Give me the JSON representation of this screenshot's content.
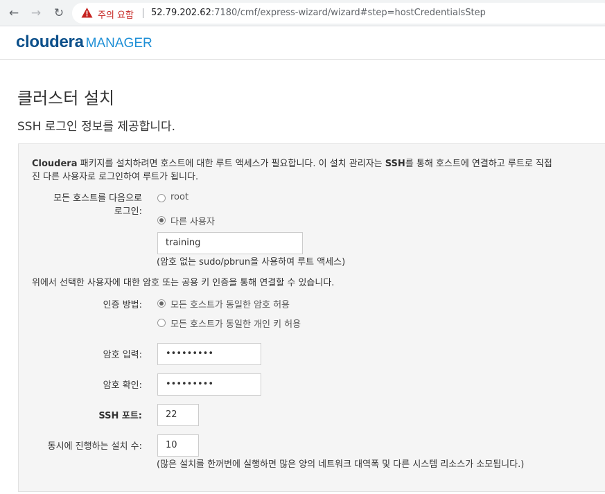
{
  "browser": {
    "warning": "주의 요함",
    "url_host": "52.79.202.62",
    "url_rest": ":7180/cmf/express-wizard/wizard#step=hostCredentialsStep"
  },
  "header": {
    "logo_brand": "cloudera",
    "logo_product": "MANAGER"
  },
  "page": {
    "title": "클러스터 설치",
    "subtitle": "SSH 로그인 정보를 제공합니다."
  },
  "intro": {
    "part1": "Cloudera",
    "part2": " 패키지를 설치하려면 호스트에 대한 루트 액세스가 필요합니다. 이 설치 관리자는 ",
    "part3": "SSH",
    "part4": "를 통해 호스트에 연결하고 루트로 직접",
    "line2": "진 다른 사용자로 로그인하여 루트가 됩니다."
  },
  "login": {
    "label_line1": "모든 호스트를 다음으로",
    "label_line2": "로그인:",
    "option_root": "root",
    "option_other": "다른 사용자",
    "username": "training",
    "username_hint": "(암호 없는 sudo/pbrun을 사용하여 루트 액세스)"
  },
  "auth_note": "위에서 선택한 사용자에 대한 암호 또는 공용 키 인증을 통해 연결할 수 있습니다.",
  "auth": {
    "label": "인증 방법:",
    "option_password": "모든 호스트가 동일한 암호 허용",
    "option_key": "모든 호스트가 동일한 개인 키 허용"
  },
  "password": {
    "label": "암호 입력:",
    "value": "•••••••••"
  },
  "confirm": {
    "label": "암호 확인:",
    "value": "•••••••••"
  },
  "ssh_port": {
    "label": "SSH 포트:",
    "value": "22"
  },
  "parallel": {
    "label": "동시에 진행하는 설치 수:",
    "value": "10",
    "hint": "(많은 설치를 한꺼번에 실행하면 많은 양의 네트워크 대역폭 및 다른 시스템 리소스가 소모됩니다.)"
  }
}
